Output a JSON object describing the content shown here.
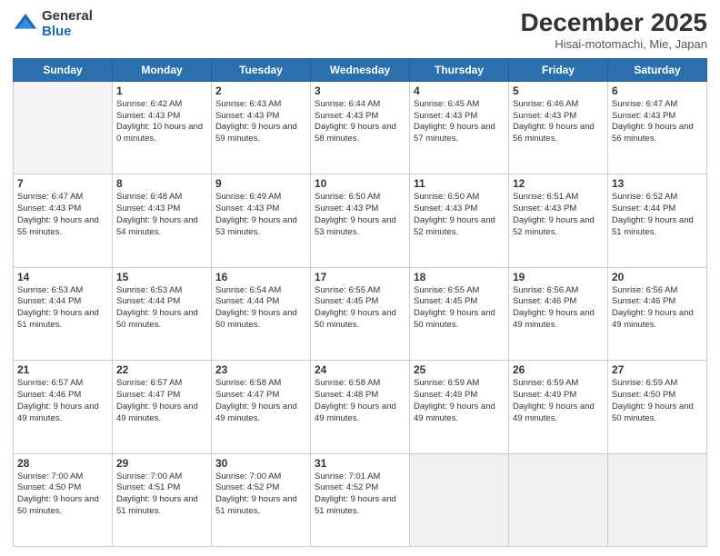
{
  "header": {
    "logo_general": "General",
    "logo_blue": "Blue",
    "month_title": "December 2025",
    "subtitle": "Hisai-motomachi, Mie, Japan"
  },
  "days_of_week": [
    "Sunday",
    "Monday",
    "Tuesday",
    "Wednesday",
    "Thursday",
    "Friday",
    "Saturday"
  ],
  "weeks": [
    [
      {
        "day": "",
        "empty": true
      },
      {
        "day": "1",
        "sunrise": "6:42 AM",
        "sunset": "4:43 PM",
        "daylight": "10 hours and 0 minutes."
      },
      {
        "day": "2",
        "sunrise": "6:43 AM",
        "sunset": "4:43 PM",
        "daylight": "9 hours and 59 minutes."
      },
      {
        "day": "3",
        "sunrise": "6:44 AM",
        "sunset": "4:43 PM",
        "daylight": "9 hours and 58 minutes."
      },
      {
        "day": "4",
        "sunrise": "6:45 AM",
        "sunset": "4:43 PM",
        "daylight": "9 hours and 57 minutes."
      },
      {
        "day": "5",
        "sunrise": "6:46 AM",
        "sunset": "4:43 PM",
        "daylight": "9 hours and 56 minutes."
      },
      {
        "day": "6",
        "sunrise": "6:47 AM",
        "sunset": "4:43 PM",
        "daylight": "9 hours and 56 minutes."
      }
    ],
    [
      {
        "day": "7",
        "sunrise": "6:47 AM",
        "sunset": "4:43 PM",
        "daylight": "9 hours and 55 minutes."
      },
      {
        "day": "8",
        "sunrise": "6:48 AM",
        "sunset": "4:43 PM",
        "daylight": "9 hours and 54 minutes."
      },
      {
        "day": "9",
        "sunrise": "6:49 AM",
        "sunset": "4:43 PM",
        "daylight": "9 hours and 53 minutes."
      },
      {
        "day": "10",
        "sunrise": "6:50 AM",
        "sunset": "4:43 PM",
        "daylight": "9 hours and 53 minutes."
      },
      {
        "day": "11",
        "sunrise": "6:50 AM",
        "sunset": "4:43 PM",
        "daylight": "9 hours and 52 minutes."
      },
      {
        "day": "12",
        "sunrise": "6:51 AM",
        "sunset": "4:43 PM",
        "daylight": "9 hours and 52 minutes."
      },
      {
        "day": "13",
        "sunrise": "6:52 AM",
        "sunset": "4:44 PM",
        "daylight": "9 hours and 51 minutes."
      }
    ],
    [
      {
        "day": "14",
        "sunrise": "6:53 AM",
        "sunset": "4:44 PM",
        "daylight": "9 hours and 51 minutes."
      },
      {
        "day": "15",
        "sunrise": "6:53 AM",
        "sunset": "4:44 PM",
        "daylight": "9 hours and 50 minutes."
      },
      {
        "day": "16",
        "sunrise": "6:54 AM",
        "sunset": "4:44 PM",
        "daylight": "9 hours and 50 minutes."
      },
      {
        "day": "17",
        "sunrise": "6:55 AM",
        "sunset": "4:45 PM",
        "daylight": "9 hours and 50 minutes."
      },
      {
        "day": "18",
        "sunrise": "6:55 AM",
        "sunset": "4:45 PM",
        "daylight": "9 hours and 50 minutes."
      },
      {
        "day": "19",
        "sunrise": "6:56 AM",
        "sunset": "4:46 PM",
        "daylight": "9 hours and 49 minutes."
      },
      {
        "day": "20",
        "sunrise": "6:56 AM",
        "sunset": "4:46 PM",
        "daylight": "9 hours and 49 minutes."
      }
    ],
    [
      {
        "day": "21",
        "sunrise": "6:57 AM",
        "sunset": "4:46 PM",
        "daylight": "9 hours and 49 minutes."
      },
      {
        "day": "22",
        "sunrise": "6:57 AM",
        "sunset": "4:47 PM",
        "daylight": "9 hours and 49 minutes."
      },
      {
        "day": "23",
        "sunrise": "6:58 AM",
        "sunset": "4:47 PM",
        "daylight": "9 hours and 49 minutes."
      },
      {
        "day": "24",
        "sunrise": "6:58 AM",
        "sunset": "4:48 PM",
        "daylight": "9 hours and 49 minutes."
      },
      {
        "day": "25",
        "sunrise": "6:59 AM",
        "sunset": "4:49 PM",
        "daylight": "9 hours and 49 minutes."
      },
      {
        "day": "26",
        "sunrise": "6:59 AM",
        "sunset": "4:49 PM",
        "daylight": "9 hours and 49 minutes."
      },
      {
        "day": "27",
        "sunrise": "6:59 AM",
        "sunset": "4:50 PM",
        "daylight": "9 hours and 50 minutes."
      }
    ],
    [
      {
        "day": "28",
        "sunrise": "7:00 AM",
        "sunset": "4:50 PM",
        "daylight": "9 hours and 50 minutes."
      },
      {
        "day": "29",
        "sunrise": "7:00 AM",
        "sunset": "4:51 PM",
        "daylight": "9 hours and 51 minutes."
      },
      {
        "day": "30",
        "sunrise": "7:00 AM",
        "sunset": "4:52 PM",
        "daylight": "9 hours and 51 minutes."
      },
      {
        "day": "31",
        "sunrise": "7:01 AM",
        "sunset": "4:52 PM",
        "daylight": "9 hours and 51 minutes."
      },
      {
        "day": "",
        "empty": true
      },
      {
        "day": "",
        "empty": true
      },
      {
        "day": "",
        "empty": true
      }
    ]
  ]
}
